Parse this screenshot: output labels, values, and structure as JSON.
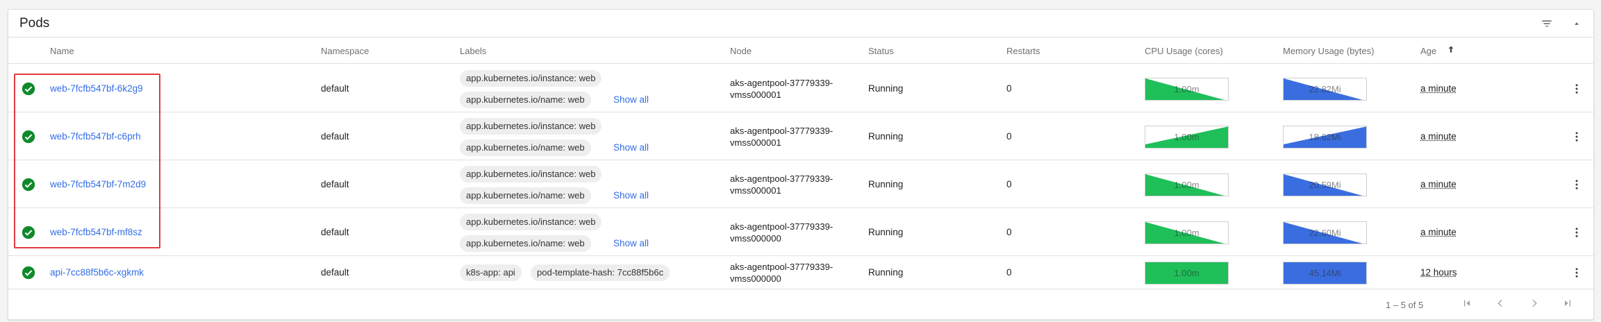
{
  "card": {
    "title": "Pods"
  },
  "columns": {
    "name": "Name",
    "namespace": "Namespace",
    "labels": "Labels",
    "node": "Node",
    "status": "Status",
    "restarts": "Restarts",
    "cpu": "CPU Usage (cores)",
    "memory": "Memory Usage (bytes)",
    "age": "Age"
  },
  "rows": [
    {
      "name": "web-7fcfb547bf-6k2g9",
      "namespace": "default",
      "labels": [
        "app.kubernetes.io/instance: web",
        "app.kubernetes.io/name: web"
      ],
      "show_all": "Show all",
      "node_line1": "aks-agentpool-37779339-",
      "node_line2": "vmss000001",
      "status": "Running",
      "restarts": "0",
      "cpu": "1.00m",
      "memory": "22.82Mi",
      "age": "a minute"
    },
    {
      "name": "web-7fcfb547bf-c6prh",
      "namespace": "default",
      "labels": [
        "app.kubernetes.io/instance: web",
        "app.kubernetes.io/name: web"
      ],
      "show_all": "Show all",
      "node_line1": "aks-agentpool-37779339-",
      "node_line2": "vmss000001",
      "status": "Running",
      "restarts": "0",
      "cpu": "1.00m",
      "memory": "18.62Mi",
      "age": "a minute"
    },
    {
      "name": "web-7fcfb547bf-7m2d9",
      "namespace": "default",
      "labels": [
        "app.kubernetes.io/instance: web",
        "app.kubernetes.io/name: web"
      ],
      "show_all": "Show all",
      "node_line1": "aks-agentpool-37779339-",
      "node_line2": "vmss000001",
      "status": "Running",
      "restarts": "0",
      "cpu": "1.00m",
      "memory": "20.59Mi",
      "age": "a minute"
    },
    {
      "name": "web-7fcfb547bf-mf8sz",
      "namespace": "default",
      "labels": [
        "app.kubernetes.io/instance: web",
        "app.kubernetes.io/name: web"
      ],
      "show_all": "Show all",
      "node_line1": "aks-agentpool-37779339-",
      "node_line2": "vmss000000",
      "status": "Running",
      "restarts": "0",
      "cpu": "1.00m",
      "memory": "22.60Mi",
      "age": "a minute"
    },
    {
      "name": "api-7cc88f5b6c-xgkmk",
      "namespace": "default",
      "labels": [
        "k8s-app: api",
        "pod-template-hash: 7cc88f5b6c"
      ],
      "node_line1": "aks-agentpool-37779339-",
      "node_line2": "vmss000000",
      "status": "Running",
      "restarts": "0",
      "cpu": "1.00m",
      "memory": "45.14Mi",
      "age": "12 hours"
    }
  ],
  "pagination": {
    "range": "1 – 5 of 5"
  },
  "colors": {
    "link": "#326de6",
    "status_ok": "#0f8a2b",
    "cpu_fill": "#1fbf5a",
    "memory_fill": "#3a6ee0",
    "highlight": "#e0393e"
  },
  "icons": {
    "status": "check-circle-icon",
    "filter": "filter-icon",
    "collapse": "chevron-up-icon",
    "row_menu": "more-vert-icon",
    "sort": "arrow-up-icon",
    "first": "first-page-icon",
    "prev": "chevron-left-icon",
    "next": "chevron-right-icon",
    "last": "last-page-icon"
  }
}
